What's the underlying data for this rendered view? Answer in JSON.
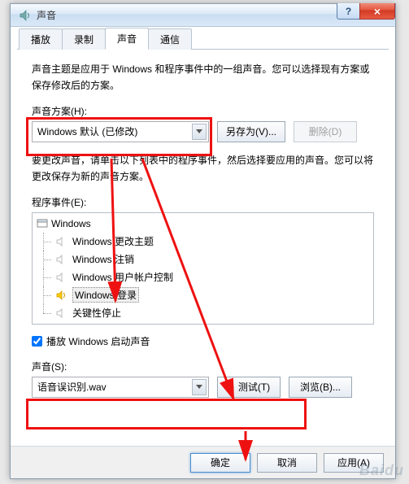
{
  "window": {
    "title": "声音",
    "help": "?",
    "close": "×"
  },
  "tabs": [
    {
      "label": "播放",
      "active": false
    },
    {
      "label": "录制",
      "active": false
    },
    {
      "label": "声音",
      "active": true
    },
    {
      "label": "通信",
      "active": false
    }
  ],
  "panel": {
    "intro": "声音主题是应用于 Windows 和程序事件中的一组声音。您可以选择现有方案或保存修改后的方案。",
    "scheme_label": "声音方案(H):",
    "scheme_value": "Windows 默认 (已修改)",
    "save_as": "另存为(V)...",
    "delete": "删除(D)",
    "change_desc": "要更改声音，请单击以下列表中的程序事件，然后选择要应用的声音。您可以将更改保存为新的声音方案。",
    "events_label": "程序事件(E):",
    "tree_root": "Windows",
    "events": [
      {
        "label": "Windows 更改主题",
        "active": false,
        "selected": false
      },
      {
        "label": "Windows 注销",
        "active": false,
        "selected": false
      },
      {
        "label": "Windows 用户帐户控制",
        "active": false,
        "selected": false
      },
      {
        "label": "Windows 登录",
        "active": true,
        "selected": true
      },
      {
        "label": "关键性停止",
        "active": false,
        "selected": false
      }
    ],
    "play_startup": "播放 Windows 启动声音",
    "sound_label": "声音(S):",
    "sound_value": "语音误识别.wav",
    "test": "测试(T)",
    "browse": "浏览(B)..."
  },
  "buttons": {
    "ok": "确定",
    "cancel": "取消",
    "apply": "应用(A)"
  },
  "watermark": "Baidu"
}
